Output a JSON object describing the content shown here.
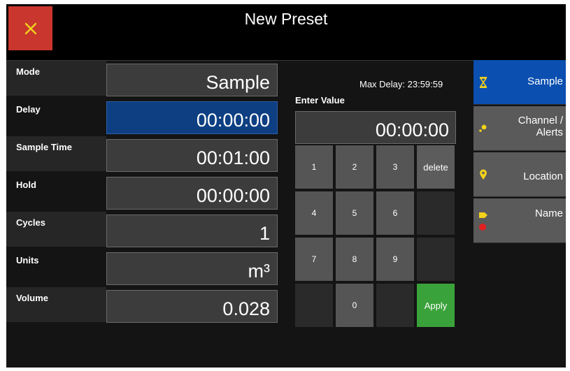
{
  "window": {
    "title": "New Preset"
  },
  "fields": [
    {
      "label": "Mode",
      "value": "Sample"
    },
    {
      "label": "Delay",
      "value": "00:00:00"
    },
    {
      "label": "Sample Time",
      "value": "00:01:00"
    },
    {
      "label": "Hold",
      "value": "00:00:00"
    },
    {
      "label": "Cycles",
      "value": "1"
    },
    {
      "label": "Units",
      "value": "m³"
    },
    {
      "label": "Volume",
      "value": "0.028"
    }
  ],
  "keypad": {
    "max_delay": "Max Delay: 23:59:59",
    "enter_value_label": "Enter Value",
    "display_value": "00:00:00",
    "keys": {
      "k1": "1",
      "k2": "2",
      "k3": "3",
      "delete": "delete",
      "k4": "4",
      "k5": "5",
      "k6": "6",
      "k7": "7",
      "k8": "8",
      "k9": "9",
      "k0": "0",
      "apply": "Apply"
    }
  },
  "sidebar": {
    "tabs": [
      {
        "label": "Sample",
        "icon": "hourglass-icon"
      },
      {
        "label": "Channel /\nAlerts",
        "icon": "alerts-icon"
      },
      {
        "label": "Location",
        "icon": "location-pin-icon"
      },
      {
        "label": "Name",
        "icon": "tag-icon"
      }
    ]
  },
  "colors": {
    "close_button": "#c9362e",
    "active_field": "#0e3f82",
    "active_tab": "#0b4fb0",
    "apply_button": "#3aa23a",
    "icon_yellow": "#f2d21b",
    "icon_red": "#e02020"
  }
}
